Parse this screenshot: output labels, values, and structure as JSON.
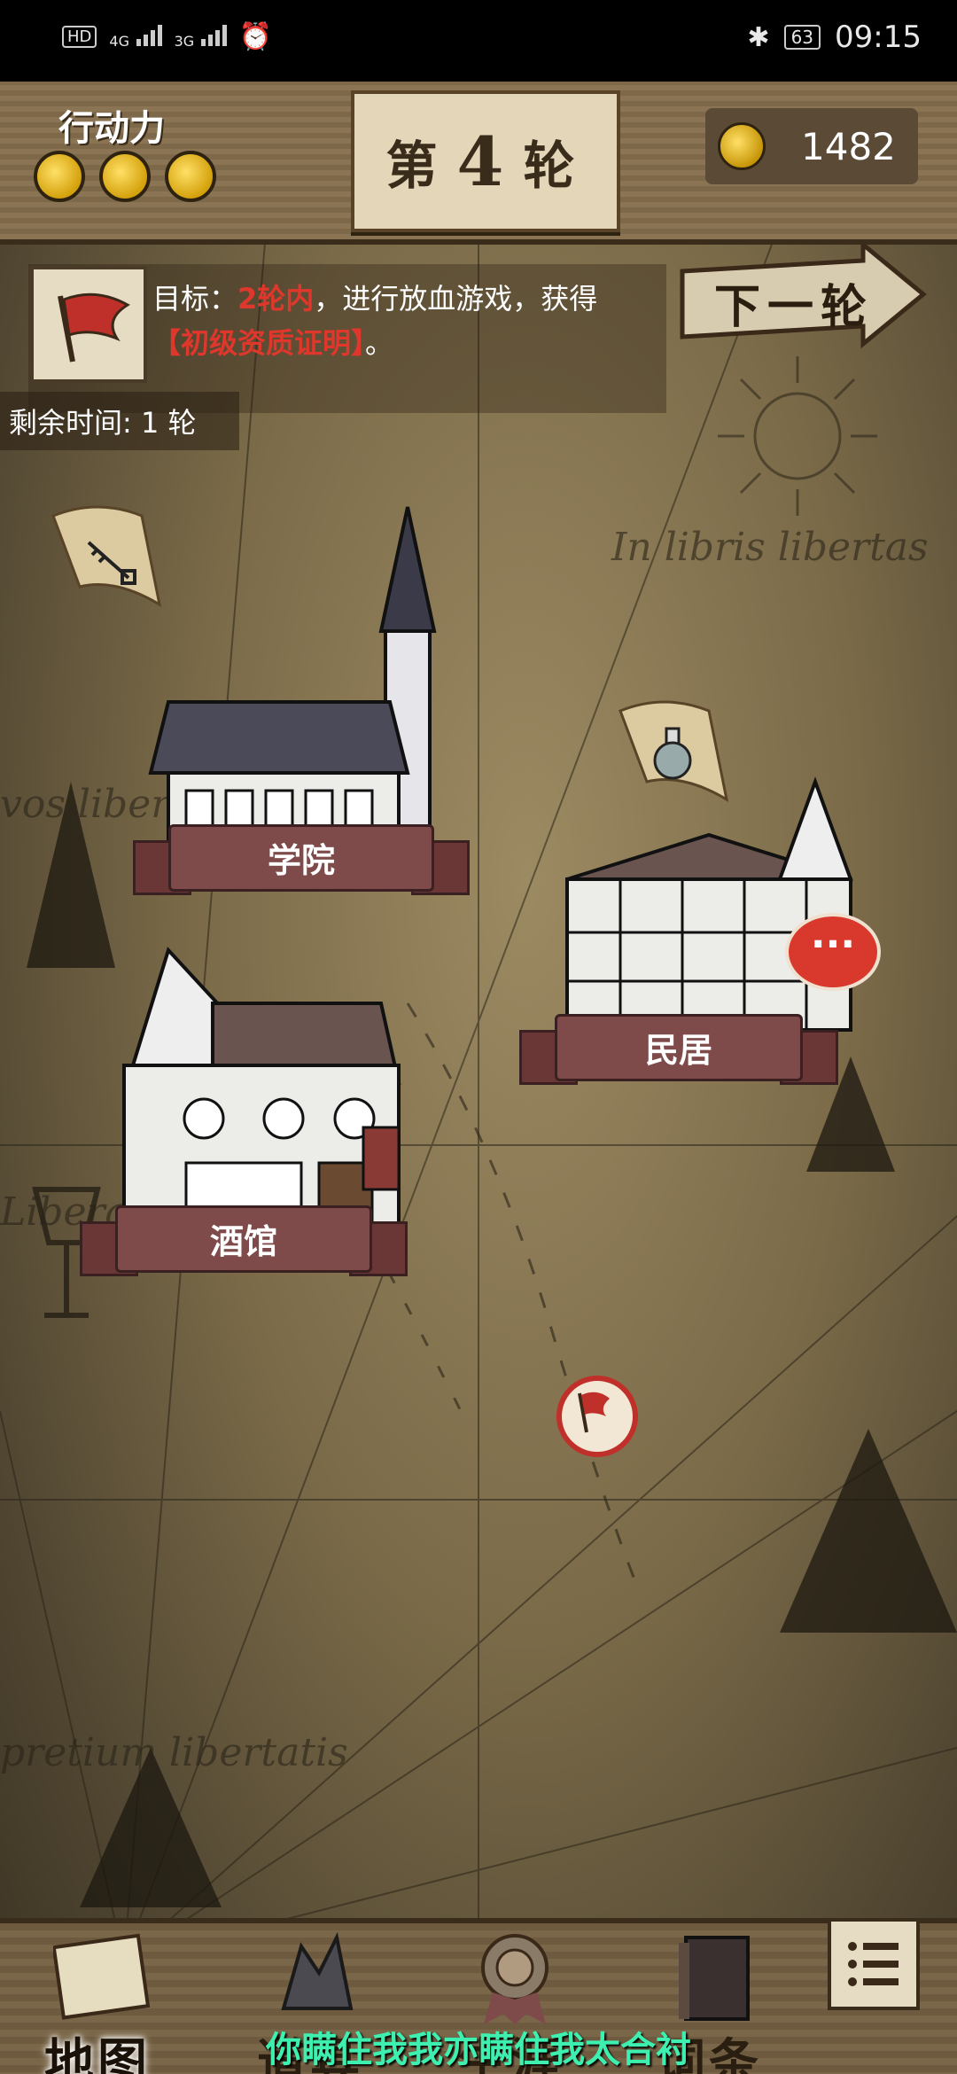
{
  "status_bar": {
    "network_left": "HD",
    "sim1": "4G",
    "sim2": "3G",
    "battery": "63",
    "time": "09:15",
    "icons": [
      "hd-icon",
      "signal-icon",
      "alarm-icon",
      "bluetooth-icon",
      "battery-icon"
    ]
  },
  "hud": {
    "action_points_label": "行动力",
    "action_points": 3,
    "round_prefix": "第",
    "round_number": "4",
    "round_suffix": "轮",
    "gold": "1482"
  },
  "goal": {
    "prefix": "目标：",
    "highlight_rounds": "2轮内",
    "middle": "，进行放血游戏，获得",
    "highlight_item": "【初级资质证明】",
    "suffix": "。",
    "remaining": "剩余时间: 1 轮"
  },
  "next_round_button": "下一轮",
  "locations": {
    "academy": "学院",
    "residence": "民居",
    "tavern": "酒馆"
  },
  "map_texts": [
    "In libris libertas",
    "vos libertas",
    "Liberamus",
    "pretium libertatis"
  ],
  "nav": [
    {
      "label": "地图",
      "icon": "map-icon",
      "active": true
    },
    {
      "label": "道具",
      "icon": "items-icon",
      "active": false
    },
    {
      "label": "生涯",
      "icon": "career-medal-icon",
      "active": false
    },
    {
      "label": "词条",
      "icon": "book-icon",
      "active": false
    }
  ],
  "subtitle": "你瞒住我我亦瞒住我太合衬",
  "colors": {
    "highlight_red": "#e0372c",
    "banner": "#7e4a4a",
    "subtitle": "#3ef0b0"
  }
}
